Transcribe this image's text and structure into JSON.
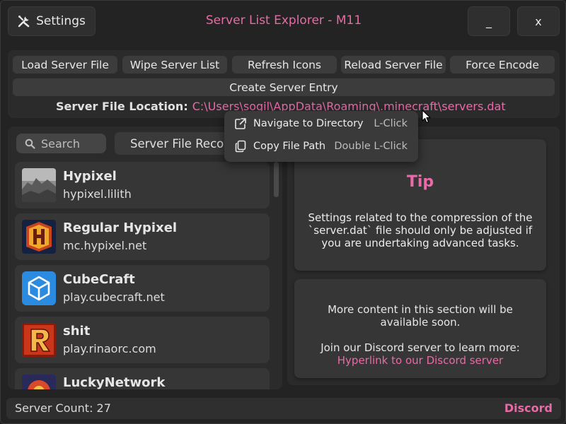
{
  "window": {
    "title": "Server List Explorer - M11",
    "settings_label": "Settings",
    "minimize_label": "_",
    "close_label": "x"
  },
  "toolbar": {
    "buttons": [
      "Load Server File",
      "Wipe Server List",
      "Refresh Icons",
      "Reload Server File",
      "Force Encode"
    ],
    "create_entry_label": "Create Server Entry",
    "location_label": "Server File Location:",
    "location_path": "C:\\Users\\sogil\\AppData\\Roaming\\.minecraft\\servers.dat"
  },
  "sidebar": {
    "search_placeholder": "Search",
    "recovery_label": "Server File Recovery"
  },
  "servers": [
    {
      "name": "Hypixel",
      "address": "hypixel.lilith",
      "icon": "landscape-icon"
    },
    {
      "name": "Regular Hypixel",
      "address": "mc.hypixel.net",
      "icon": "hypixel-h-icon"
    },
    {
      "name": "CubeCraft",
      "address": "play.cubecraft.net",
      "icon": "cube-icon"
    },
    {
      "name": "shit",
      "address": "play.rinaorc.com",
      "icon": "rinaorc-r-icon"
    },
    {
      "name": "LuckyNetwork",
      "address": "",
      "icon": "lucky-icon"
    }
  ],
  "tip": {
    "title": "Tip",
    "text": "Settings related to the compression of the `server.dat` file should only be adjusted if you are undertaking advanced tasks."
  },
  "info": {
    "soon_text": "More content in this section will be available soon.",
    "join_text": "Join our Discord server to learn more:",
    "link_text": "Hyperlink to our Discord server"
  },
  "status": {
    "server_count": "Server Count: 27",
    "discord_label": "Discord"
  },
  "context_menu": {
    "items": [
      {
        "label": "Navigate to Directory",
        "shortcut": "L-Click",
        "icon": "external-link-icon"
      },
      {
        "label": "Copy File Path",
        "shortcut": "Double L-Click",
        "icon": "copy-icon"
      }
    ]
  },
  "colors": {
    "accent": "#e86aa6",
    "background": "#232323",
    "panel": "#2b2b2b",
    "card": "#363636",
    "button": "#3c3c3c"
  }
}
